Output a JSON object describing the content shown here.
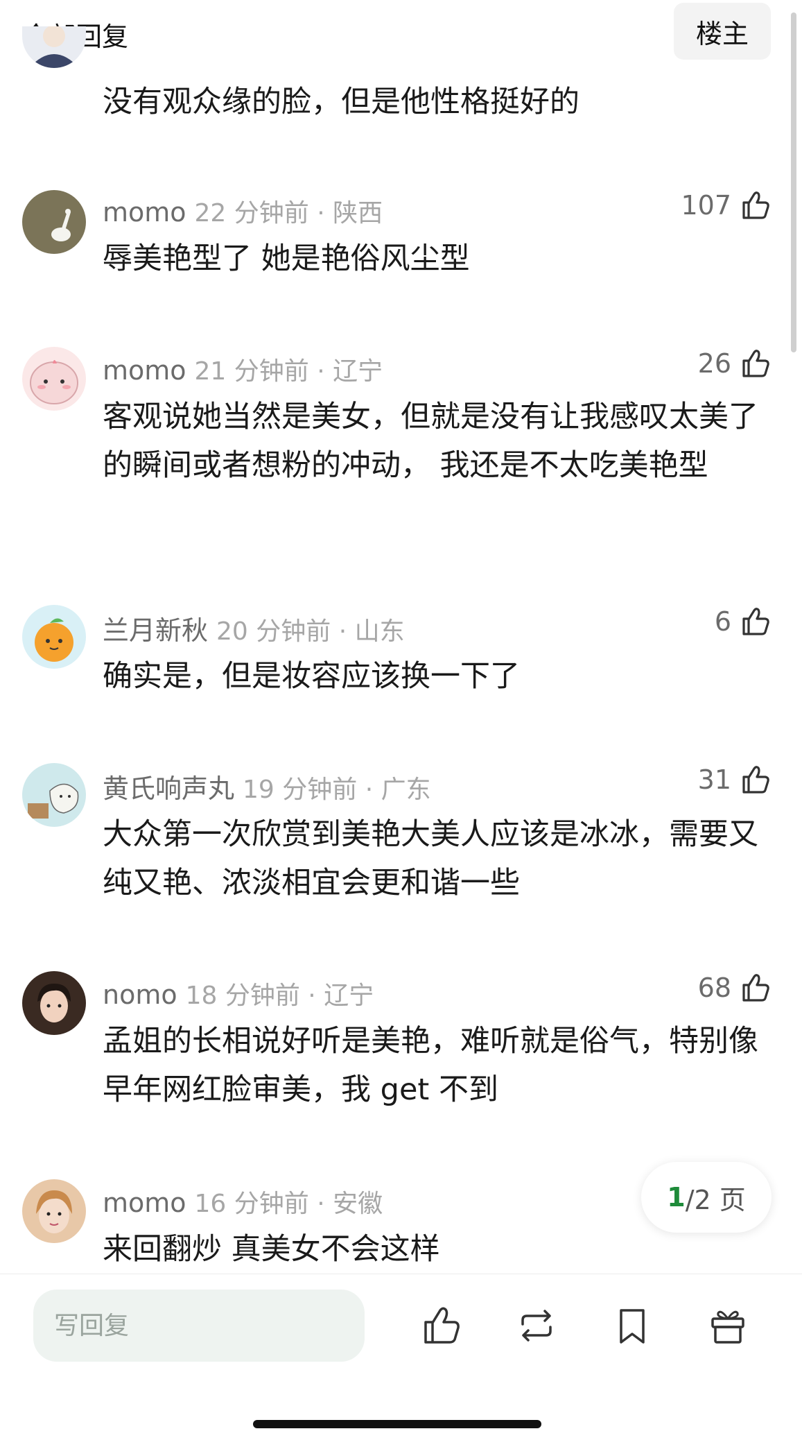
{
  "header": {
    "title": "全部回复",
    "owner_button": "楼主"
  },
  "comments": [
    {
      "text": "没有观众缘的脸，但是他性格挺好的"
    },
    {
      "user": "momo",
      "time": "22 分钟前 · 陕西",
      "likes": "107",
      "text": "辱美艳型了 她是艳俗风尘型"
    },
    {
      "user": "momo",
      "time": "21 分钟前 · 辽宁",
      "likes": "26",
      "text": "客观说她当然是美女，但就是没有让我感叹太美了的瞬间或者想粉的冲动， 我还是不太吃美艳型"
    },
    {
      "user": "兰月新秋",
      "time": "20 分钟前 · 山东",
      "likes": "6",
      "text": "确实是，但是妆容应该换一下了"
    },
    {
      "user": "黄氏响声丸",
      "time": "19 分钟前 · 广东",
      "likes": "31",
      "text": "大众第一次欣赏到美艳大美人应该是冰冰，需要又纯又艳、浓淡相宜会更和谐一些"
    },
    {
      "user": "nomo",
      "time": "18 分钟前 · 辽宁",
      "likes": "68",
      "text": "孟姐的长相说好听是美艳，难听就是俗气，特别像早年网红脸审美，我 get 不到"
    },
    {
      "user": "momo",
      "time": "16 分钟前 · 安徽",
      "text": "来回翻炒 真美女不会这样"
    }
  ],
  "pagination": {
    "current": "1",
    "rest": "/2 页"
  },
  "bottom_bar": {
    "reply_placeholder": "写回复",
    "icons": [
      "like-icon",
      "repost-icon",
      "bookmark-icon",
      "gift-icon"
    ]
  }
}
